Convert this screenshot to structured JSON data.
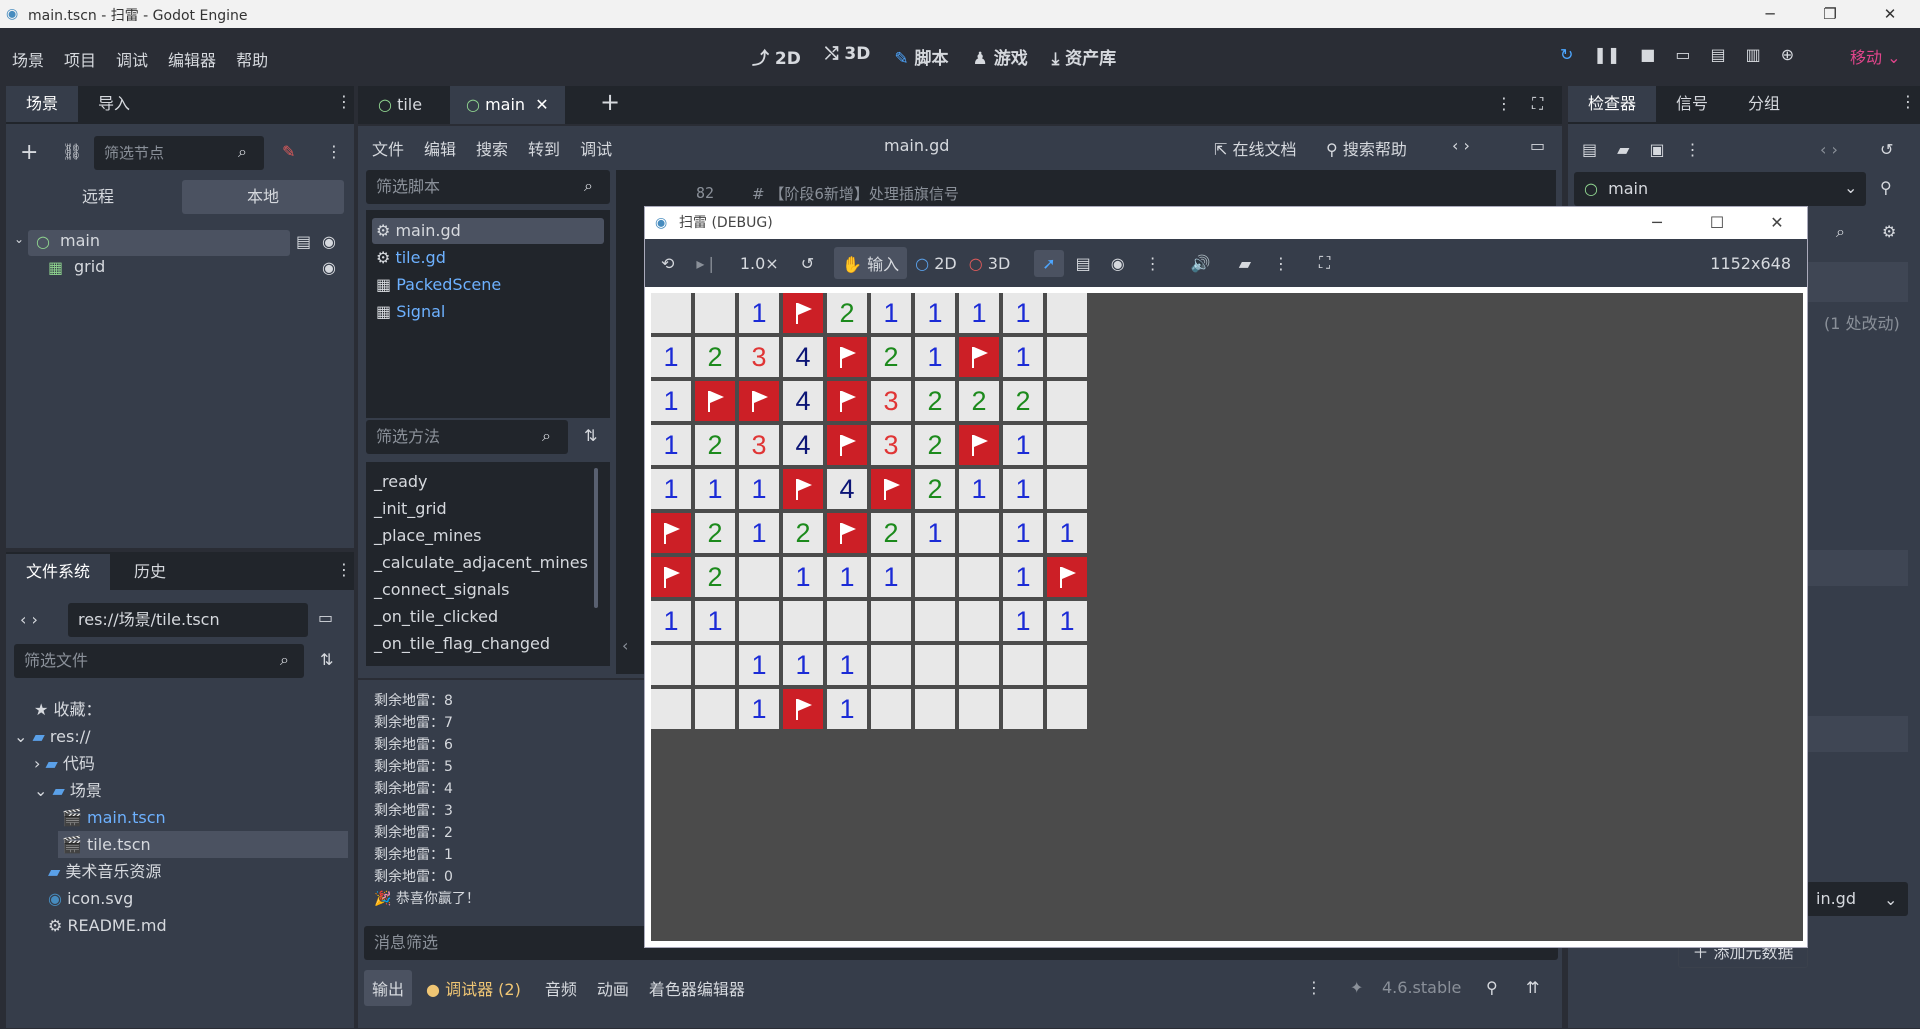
{
  "window": {
    "title": "main.tscn - 扫雷 - Godot Engine"
  },
  "menu": [
    "场景",
    "项目",
    "调试",
    "编辑器",
    "帮助"
  ],
  "modes": {
    "m2d": "2D",
    "m3d": "3D",
    "script": "脚本",
    "game": "游戏",
    "assetlib": "资产库"
  },
  "mobile": "移动",
  "scene_dock": {
    "tabs": [
      "场景",
      "导入"
    ],
    "filter_placeholder": "筛选节点",
    "remote": "远程",
    "local": "本地",
    "nodes": [
      "main",
      "grid"
    ]
  },
  "fs_dock": {
    "tabs": [
      "文件系统",
      "历史"
    ],
    "path": "res://场景/tile.tscn",
    "filter_placeholder": "筛选文件",
    "items": [
      "收藏：",
      "res://",
      "代码",
      "场景",
      "main.tscn",
      "tile.tscn",
      "美术音乐资源",
      "icon.svg",
      "README.md"
    ]
  },
  "editor_tabs": [
    "tile",
    "main"
  ],
  "script_menu": [
    "文件",
    "编辑",
    "搜索",
    "转到",
    "调试"
  ],
  "script_file": "main.gd",
  "online_docs": "在线文档",
  "search_help": "搜索帮助",
  "script_filter_placeholder": "筛选脚本",
  "scripts": [
    "main.gd",
    "tile.gd",
    "PackedScene",
    "Signal"
  ],
  "method_filter_placeholder": "筛选方法",
  "methods": [
    "_ready",
    "_init_grid",
    "_place_mines",
    "_calculate_adjacent_mines",
    "_connect_signals",
    "_on_tile_clicked",
    "_on_tile_flag_changed"
  ],
  "code_line": {
    "num": "82",
    "text": "# 【阶段6新增】处理插旗信号"
  },
  "output": [
    "剩余地雷：8",
    "剩余地雷：7",
    "剩余地雷：6",
    "剩余地雷：5",
    "剩余地雷：4",
    "剩余地雷：3",
    "剩余地雷：2",
    "剩余地雷：1",
    "剩余地雷：0",
    "恭喜你赢了！"
  ],
  "msg_filter_placeholder": "消息筛选",
  "bottom_tabs": [
    "输出",
    "调试器 (2)",
    "音频",
    "动画",
    "着色器编辑器"
  ],
  "version": "4.6.stable",
  "inspector": {
    "tabs": [
      "检查器",
      "信号",
      "分组"
    ],
    "node": "main",
    "changes": "(1 处改动)",
    "script": "in.gd",
    "add_meta": "添加元数据"
  },
  "debug": {
    "title": "扫雷 (DEBUG)",
    "speed": "1.0×",
    "input": "输入",
    "d2": "2D",
    "d3": "3D",
    "resolution": "1152x648"
  },
  "grid": [
    [
      "",
      "",
      "1",
      "F",
      "2",
      "1",
      "1",
      "1",
      "1",
      ""
    ],
    [
      "1",
      "2",
      "3",
      "4",
      "F",
      "2",
      "1",
      "F",
      "1",
      ""
    ],
    [
      "1",
      "F",
      "F",
      "4",
      "F",
      "3",
      "2",
      "2",
      "2",
      ""
    ],
    [
      "1",
      "2",
      "3",
      "4",
      "F",
      "3",
      "2",
      "F",
      "1",
      ""
    ],
    [
      "1",
      "1",
      "1",
      "F",
      "4",
      "F",
      "2",
      "1",
      "1",
      ""
    ],
    [
      "F",
      "2",
      "1",
      "2",
      "F",
      "2",
      "1",
      "",
      "1",
      "1"
    ],
    [
      "F",
      "2",
      "",
      "1",
      "1",
      "1",
      "",
      "",
      "1",
      "F"
    ],
    [
      "1",
      "1",
      "",
      "",
      "",
      "",
      "",
      "",
      "1",
      "1"
    ],
    [
      "",
      "",
      "1",
      "1",
      "1",
      "",
      "",
      "",
      "",
      ""
    ],
    [
      "",
      "",
      "1",
      "F",
      "1",
      "",
      "",
      "",
      "",
      ""
    ]
  ],
  "colors": {
    "flag": "#cc1f26",
    "n1": "#1b2bd6",
    "n2": "#1c8a1c",
    "n3": "#e03535",
    "n4": "#0c1576",
    "accent": "#4da6ff"
  }
}
